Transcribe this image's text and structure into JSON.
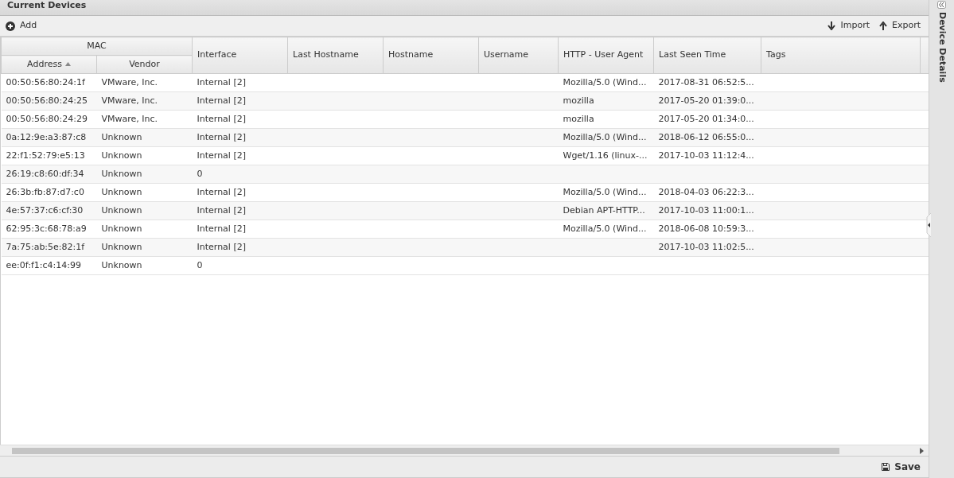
{
  "panel": {
    "title": "Current Devices"
  },
  "toolbar": {
    "left": [
      {
        "kind": "add",
        "label": "Add"
      }
    ],
    "right": [
      {
        "kind": "import",
        "label": "Import"
      },
      {
        "kind": "export",
        "label": "Export"
      }
    ]
  },
  "table": {
    "group_label": "MAC",
    "columns": [
      {
        "label": "Address",
        "grouped": true,
        "sorted": true
      },
      {
        "label": "Vendor",
        "grouped": true
      },
      {
        "label": "Interface",
        "grouped": false
      },
      {
        "label": "Last Hostname",
        "grouped": false
      },
      {
        "label": "Hostname",
        "grouped": false
      },
      {
        "label": "Username",
        "grouped": false
      },
      {
        "label": "HTTP - User Agent",
        "grouped": false
      },
      {
        "label": "Last Seen Time",
        "grouped": false
      },
      {
        "label": "Tags",
        "grouped": false
      }
    ],
    "rows": [
      [
        "00:50:56:80:24:1f",
        "VMware, Inc.",
        "Internal [2]",
        null,
        null,
        null,
        "Mozilla/5.0 (Wind...",
        "2017-08-31 06:52:5...",
        null
      ],
      [
        "00:50:56:80:24:25",
        "VMware, Inc.",
        "Internal [2]",
        null,
        null,
        null,
        "mozilla",
        "2017-05-20 01:39:0...",
        null
      ],
      [
        "00:50:56:80:24:29",
        "VMware, Inc.",
        "Internal [2]",
        null,
        null,
        null,
        "mozilla",
        "2017-05-20 01:34:0...",
        null
      ],
      [
        "0a:12:9e:a3:87:c8",
        "Unknown",
        "Internal [2]",
        null,
        null,
        null,
        "Mozilla/5.0 (Wind...",
        "2018-06-12 06:55:0...",
        null
      ],
      [
        "22:f1:52:79:e5:13",
        "Unknown",
        "Internal [2]",
        null,
        null,
        null,
        "Wget/1.16 (linux-...",
        "2017-10-03 11:12:4...",
        null
      ],
      [
        "26:19:c8:60:df:34",
        "Unknown",
        "0",
        null,
        null,
        null,
        null,
        null,
        null
      ],
      [
        "26:3b:fb:87:d7:c0",
        "Unknown",
        "Internal [2]",
        null,
        null,
        null,
        "Mozilla/5.0 (Wind...",
        "2018-04-03 06:22:3...",
        null
      ],
      [
        "4e:57:37:c6:cf:30",
        "Unknown",
        "Internal [2]",
        null,
        null,
        null,
        "Debian APT-HTTP...",
        "2017-10-03 11:00:1...",
        null
      ],
      [
        "62:95:3c:68:78:a9",
        "Unknown",
        "Internal [2]",
        null,
        null,
        null,
        "Mozilla/5.0 (Wind...",
        "2018-06-08 10:59:3...",
        null
      ],
      [
        "7a:75:ab:5e:82:1f",
        "Unknown",
        "Internal [2]",
        null,
        null,
        null,
        null,
        "2017-10-03 11:02:5...",
        null
      ],
      [
        "ee:0f:f1:c4:14:99",
        "Unknown",
        "0",
        null,
        null,
        null,
        null,
        null,
        null
      ]
    ]
  },
  "side_panel": {
    "title": "Device Details"
  },
  "footer": {
    "button": "Save"
  }
}
